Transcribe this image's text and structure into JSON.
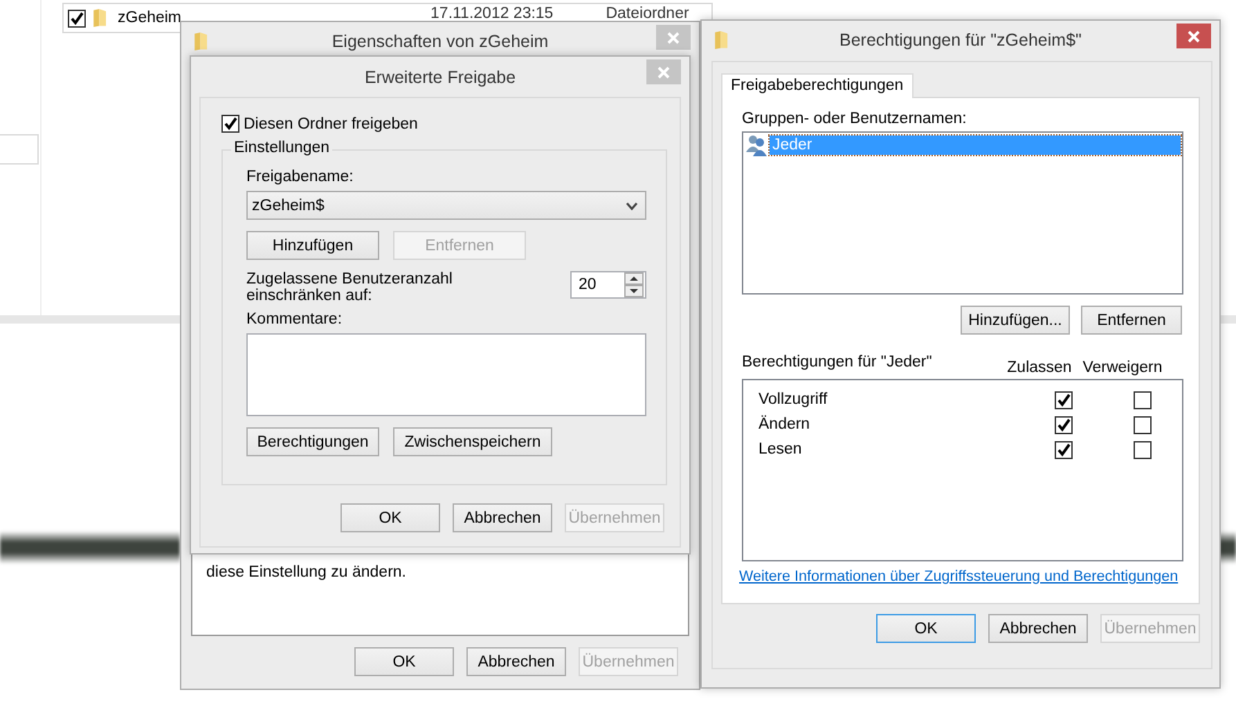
{
  "explorer": {
    "row": {
      "checked": true,
      "name": "zGeheim",
      "date": "17.11.2012 23:15",
      "type": "Dateiordner"
    }
  },
  "properties_window": {
    "title": "Eigenschaften von zGeheim",
    "active": false,
    "note": "diese Einstellung zu ändern.",
    "buttons": [
      {
        "label": "OK",
        "disabled": false
      },
      {
        "label": "Abbrechen",
        "disabled": false
      },
      {
        "label": "Übernehmen",
        "disabled": true
      }
    ]
  },
  "advanced_sharing": {
    "title": "Erweiterte Freigabe",
    "active": false,
    "share_checkbox": {
      "label": "Diesen Ordner freigeben",
      "checked": true
    },
    "group_label": "Einstellungen",
    "share_name_label": "Freigabename:",
    "share_name": "zGeheim$",
    "name_buttons": [
      {
        "label": "Hinzufügen",
        "disabled": false
      },
      {
        "label": "Entfernen",
        "disabled": true
      }
    ],
    "limit_label": "Zugelassene Benutzeranzahl einschränken auf:",
    "limit_value": "20",
    "comments_label": "Kommentare:",
    "extra_buttons": [
      {
        "label": "Berechtigungen",
        "disabled": false
      },
      {
        "label": "Zwischenspeichern",
        "disabled": false
      }
    ],
    "buttons": [
      {
        "label": "OK",
        "disabled": false
      },
      {
        "label": "Abbrechen",
        "disabled": false
      },
      {
        "label": "Übernehmen",
        "disabled": true
      }
    ]
  },
  "permissions_window": {
    "title": "Berechtigungen für \"zGeheim$\"",
    "active": true,
    "tabs": [
      {
        "label": "Freigabeberechtigungen",
        "selected": true
      }
    ],
    "users_label": "Gruppen- oder Benutzernamen:",
    "users": [
      {
        "name": "Jeder",
        "selected": true
      }
    ],
    "user_buttons": [
      {
        "label": "Hinzufügen...",
        "disabled": false
      },
      {
        "label": "Entfernen",
        "disabled": false
      }
    ],
    "permissions_label": "Berechtigungen für \"Jeder\"",
    "columns": [
      "Zulassen",
      "Verweigern"
    ],
    "permissions": [
      {
        "name": "Vollzugriff",
        "allow": true,
        "deny": false
      },
      {
        "name": "Ändern",
        "allow": true,
        "deny": false
      },
      {
        "name": "Lesen",
        "allow": true,
        "deny": false
      }
    ],
    "link": "Weitere Informationen über Zugriffssteuerung und Berechtigungen",
    "buttons": [
      {
        "label": "OK",
        "disabled": false,
        "focused": true
      },
      {
        "label": "Abbrechen",
        "disabled": false,
        "focused": false
      },
      {
        "label": "Übernehmen",
        "disabled": true,
        "focused": false
      }
    ]
  }
}
